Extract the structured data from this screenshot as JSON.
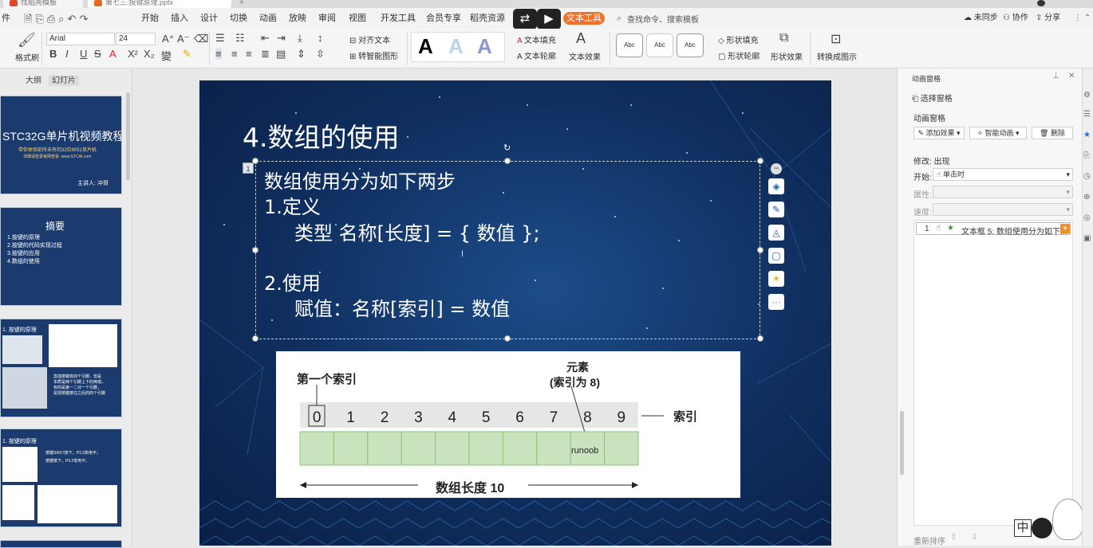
{
  "titlebar": {
    "tabs": [
      {
        "label": "找稻壳模板"
      },
      {
        "label": "第七三:按键原理.pptx"
      }
    ]
  },
  "menubar": {
    "file_label": "件",
    "items": [
      "开始",
      "插入",
      "设计",
      "切换",
      "动画",
      "放映",
      "审阅",
      "视图",
      "开发工具",
      "会员专享",
      "稻壳资源"
    ],
    "tool_tab": "文本工具",
    "search_placeholder": "查找命令、搜索模板",
    "right": {
      "sync": "未同步",
      "collab": "协作",
      "share": "分享"
    }
  },
  "ribbon": {
    "format_painter": "格式刷",
    "font_name": "Arial",
    "font_size": "24",
    "align_text": "对齐文本",
    "convert_smartart": "转智能图形",
    "text_fill": "文本填充",
    "text_outline": "文本轮廓",
    "text_effect": "文本效果",
    "shape_samples": [
      "Abc",
      "Abc",
      "Abc"
    ],
    "shape_fill": "形状填充",
    "shape_outline": "形状轮廓",
    "shape_effect": "形状效果",
    "convert_picture": "转换成图示"
  },
  "leftpanel": {
    "tabs": {
      "outline": "大纲",
      "slides": "幻灯片"
    },
    "thumb1": {
      "title": "STC32G单片机视频教程",
      "sub1": "带你体验前所未有的32位8051单片机",
      "sub2": "详细请登录官网查看: www.STCAI.com",
      "author": "主讲人: 冲哥"
    },
    "thumb2": {
      "title": "摘要",
      "items": [
        "1.按键的原理",
        "2.按键的代码实现过程",
        "3.按键的应用",
        "4.数组的使用"
      ]
    },
    "thumb3": {
      "title": "1. 按键的原理",
      "desc": [
        "直插按键有四个引脚，但是",
        "本质是两个引脚上下的两端，",
        "有的是第一二对一个引脚，",
        "是把按键按住之后的四个引脚"
      ]
    },
    "thumb4": {
      "title": "1. 按键的原理",
      "desc1": "按键SW17按下，P3.2高电平；",
      "desc2": "按键按下，P3.2低电平。"
    }
  },
  "slide": {
    "title": "4.数组的使用",
    "number_badge": "1",
    "lines": [
      "数组使用分为如下两步",
      "1.定义",
      "类型 名称[长度] = { 数值 };",
      "2.使用",
      "赋值：名称[索引] = 数值"
    ],
    "figure": {
      "first_index_label": "第一个索引",
      "element_label_1": "元素",
      "element_label_2": "(索引为 8)",
      "indices": [
        "0",
        "1",
        "2",
        "3",
        "4",
        "5",
        "6",
        "7",
        "8",
        "9"
      ],
      "index_label": "索引",
      "cell_text": "runoob",
      "length_label": "数组长度 10"
    }
  },
  "rightpanel": {
    "header": "动画窗格",
    "select_pane": "选择窗格",
    "anim_pane": "动画窗格",
    "add_effect": "添加效果",
    "smart_anim": "智能动画",
    "delete": "删除",
    "modify": "修改: 出现",
    "start_label": "开始:",
    "start_value": "单击时",
    "property_label": "属性:",
    "speed_label": "速度:",
    "anim_item_num": "1",
    "anim_item_text": "文本框 5: 数组使用分为如下...",
    "reorder": "重新排序"
  },
  "colors": {
    "accent": "#f0712a",
    "slide_bg": "#0f2e5e",
    "green_cell": "#c8e3bd"
  }
}
